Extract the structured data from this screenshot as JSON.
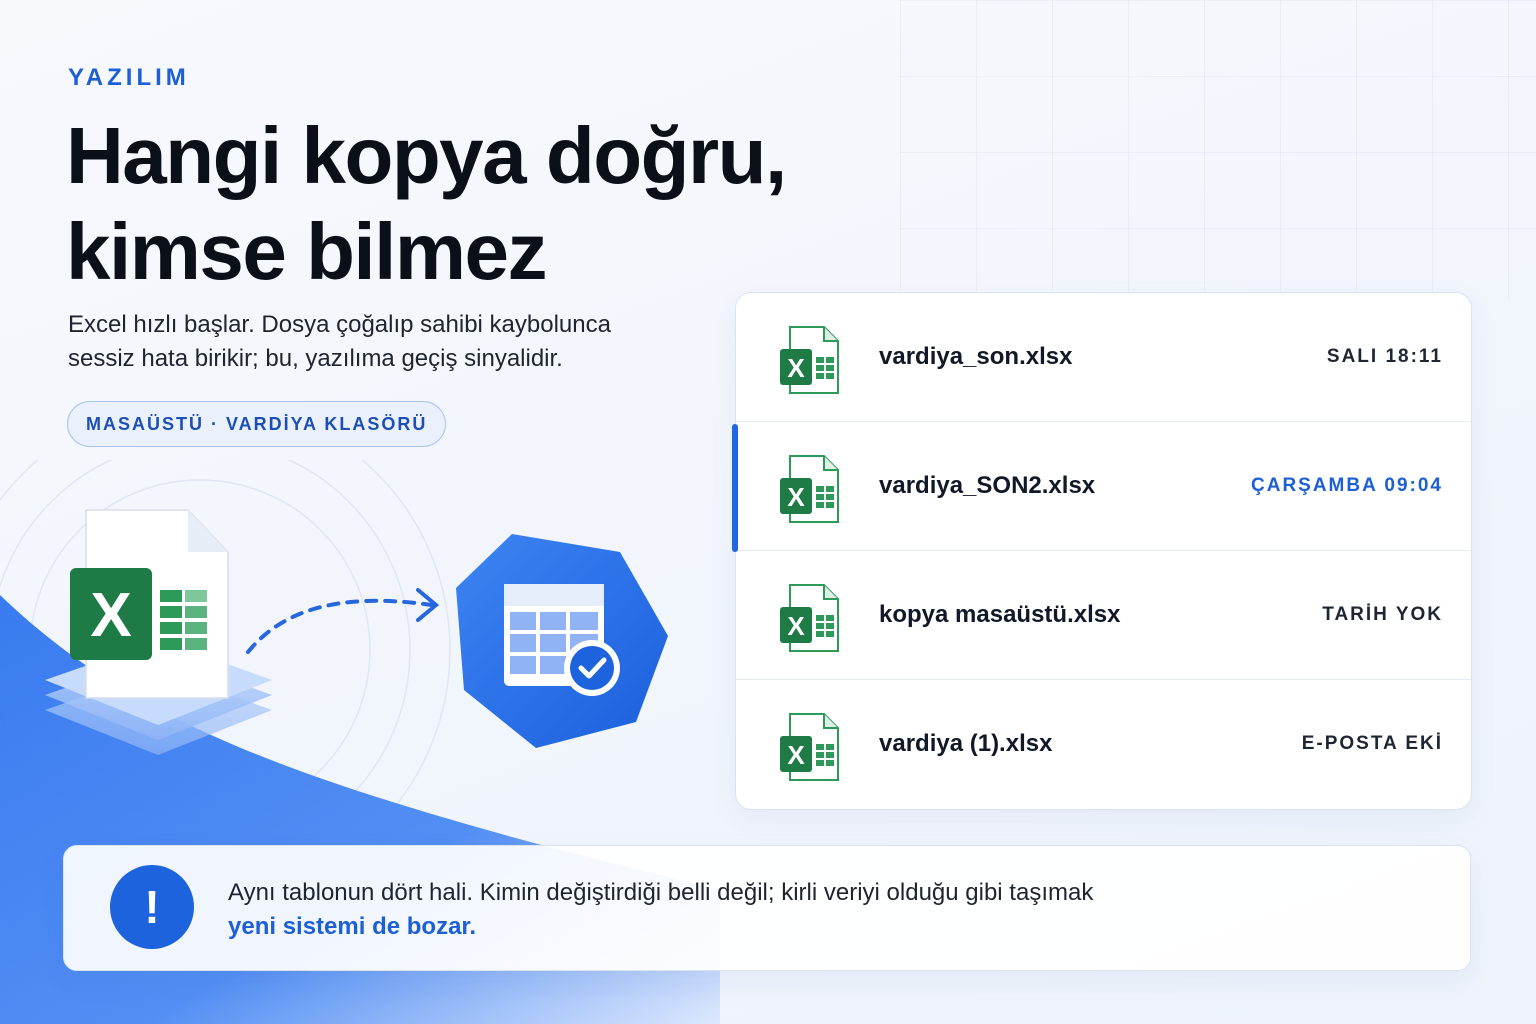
{
  "eyebrow": "YAZILIM",
  "headline_line1": "Hangi kopya doğru,",
  "headline_line2": "kimse bilmez",
  "subtitle_line1": "Excel hızlı başlar. Dosya çoğalıp sahibi kaybolunca",
  "subtitle_line2": "sessiz hata birikir; bu, yazılıma geçiş sinyalidir.",
  "folder_pill": "MASAÜSTÜ · VARDİYA KLASÖRÜ",
  "files": [
    {
      "name": "vardiya_son.xlsx",
      "meta": "SALI 18:11",
      "icon": "excel-file-icon",
      "active": false
    },
    {
      "name": "vardiya_SON2.xlsx",
      "meta": "ÇARŞAMBA 09:04",
      "icon": "excel-file-icon",
      "active": true
    },
    {
      "name": "kopya masaüstü.xlsx",
      "meta": "TARİH YOK",
      "icon": "excel-file-icon",
      "active": false
    },
    {
      "name": "vardiya (1).xlsx",
      "meta": "E-POSTA EKİ",
      "icon": "excel-file-icon",
      "active": false
    }
  ],
  "alert": {
    "icon": "exclamation-icon",
    "text": "Aynı tablonun dört hali. Kimin değiştirdiği belli değil; kirli veriyi olduğu gibi taşımak",
    "emphasis": "yeni sistemi de bozar."
  },
  "illustration": {
    "left_icon": "excel-stack-icon",
    "arrow": "dashed-arrow-icon",
    "right_icon": "verified-table-icon",
    "excel_letter": "X"
  },
  "colors": {
    "accent": "#1c5fd6",
    "excel_green": "#1e7b45",
    "blue_wave": "#2f74ef"
  }
}
